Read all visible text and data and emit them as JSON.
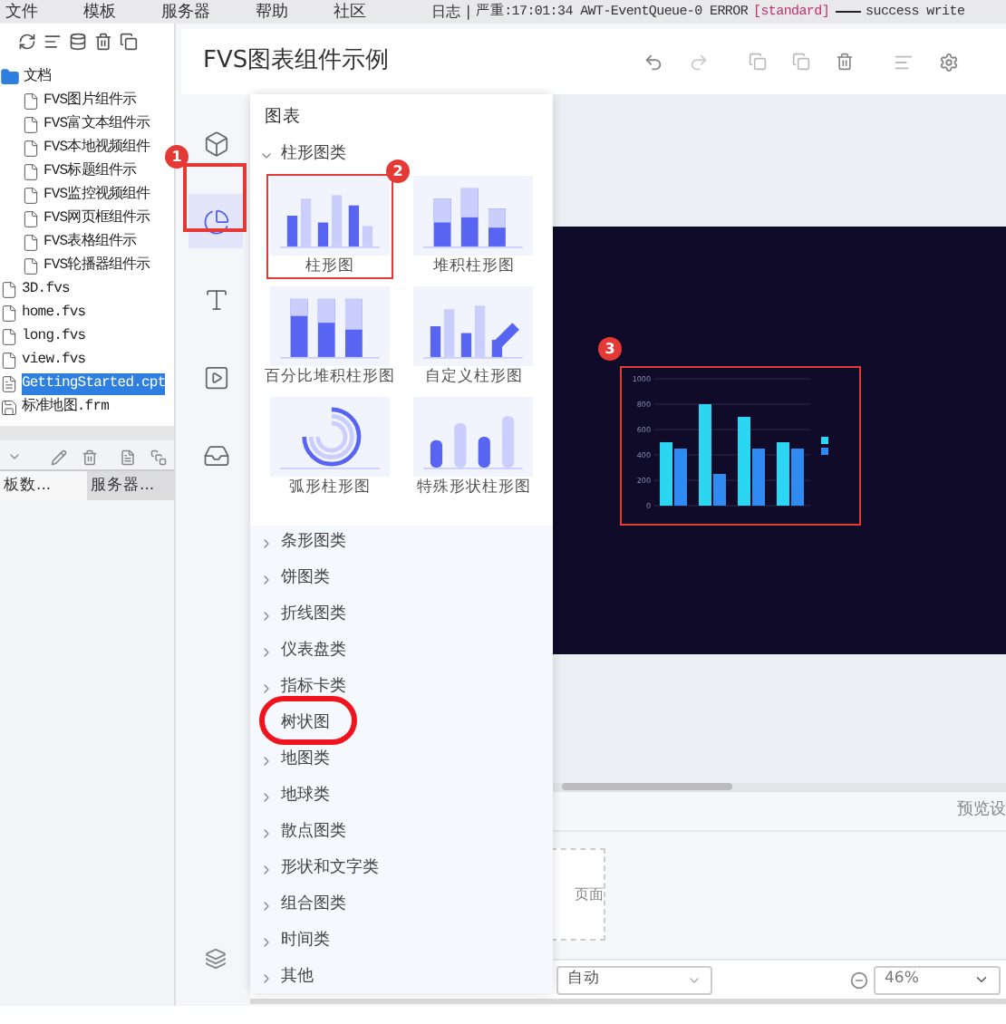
{
  "menubar": {
    "items": [
      "文件",
      "模板",
      "服务器",
      "帮助",
      "社区"
    ],
    "log": {
      "label": "日志",
      "separator": "|",
      "message": "严重:17:01:34 AWT-EventQueue-0 ERROR",
      "tag": "[standard]",
      "tail": "success write"
    }
  },
  "file_tree": [
    {
      "label": "文档",
      "kind": "folder",
      "selected": false,
      "children": [
        {
          "label": "FVS图片组件示",
          "kind": "file",
          "selected": false
        },
        {
          "label": "FVS富文本组件示",
          "kind": "file",
          "selected": false
        },
        {
          "label": "FVS本地视频组件",
          "kind": "file",
          "selected": false
        },
        {
          "label": "FVS标题组件示",
          "kind": "file",
          "selected": false
        },
        {
          "label": "FVS监控视频组件",
          "kind": "file",
          "selected": false
        },
        {
          "label": "FVS网页框组件示",
          "kind": "file",
          "selected": false
        },
        {
          "label": "FVS表格组件示",
          "kind": "file",
          "selected": false
        },
        {
          "label": "FVS轮播器组件示",
          "kind": "file",
          "selected": false
        }
      ]
    },
    {
      "label": "3D.fvs",
      "kind": "file",
      "selected": false
    },
    {
      "label": "home.fvs",
      "kind": "file",
      "selected": false
    },
    {
      "label": "long.fvs",
      "kind": "file",
      "selected": false
    },
    {
      "label": "view.fvs",
      "kind": "file",
      "selected": false
    },
    {
      "label": "GettingStarted.cpt",
      "kind": "report",
      "selected": true
    },
    {
      "label": "标准地图.frm",
      "kind": "form",
      "selected": false
    }
  ],
  "left_tabs": [
    {
      "label": "板数...",
      "selected": false
    },
    {
      "label": "服务器...",
      "selected": true
    }
  ],
  "editor": {
    "title": "FVS图表组件示例"
  },
  "rail": [
    {
      "selected": false
    },
    {
      "selected": true
    },
    {
      "selected": false
    },
    {
      "selected": false
    },
    {
      "selected": false
    }
  ],
  "chart_panel": {
    "title": "图表",
    "groups": [
      {
        "label": "柱形图类",
        "kind": "group",
        "expanded": true,
        "tiles": [
          {
            "label": "柱形图",
            "selected": true
          },
          {
            "label": "堆积柱形图",
            "selected": false
          },
          {
            "label": "百分比堆积柱形图",
            "selected": false
          },
          {
            "label": "自定义柱形图",
            "selected": false
          },
          {
            "label": "弧形柱形图",
            "selected": false
          },
          {
            "label": "特殊形状柱形图",
            "selected": false
          }
        ]
      },
      {
        "label": "条形图类",
        "kind": "group",
        "expanded": false
      },
      {
        "label": "饼图类",
        "kind": "group",
        "expanded": false
      },
      {
        "label": "折线图类",
        "kind": "group",
        "expanded": false
      },
      {
        "label": "仪表盘类",
        "kind": "group",
        "expanded": false
      },
      {
        "label": "指标卡类",
        "kind": "group",
        "expanded": false
      },
      {
        "label": "树状图",
        "kind": "leaf"
      },
      {
        "label": "地图类",
        "kind": "group",
        "expanded": false
      },
      {
        "label": "地球类",
        "kind": "group",
        "expanded": false
      },
      {
        "label": "散点图类",
        "kind": "group",
        "expanded": false
      },
      {
        "label": "形状和文字类",
        "kind": "group",
        "expanded": false
      },
      {
        "label": "组合图类",
        "kind": "group",
        "expanded": false
      },
      {
        "label": "时间类",
        "kind": "group",
        "expanded": false
      },
      {
        "label": "其他",
        "kind": "group",
        "expanded": false
      }
    ]
  },
  "annotations": [
    {
      "number": "1"
    },
    {
      "number": "2"
    },
    {
      "number": "3"
    }
  ],
  "canvas": {
    "chart_data": {
      "type": "bar",
      "grid": true,
      "yticks": [
        0,
        200,
        400,
        600,
        800,
        1000
      ],
      "ylim": [
        0,
        1000
      ],
      "series": [
        {
          "color": "#2bd6f2",
          "values": [
            500,
            800,
            700,
            500
          ]
        },
        {
          "color": "#2f8bf2",
          "values": [
            450,
            250,
            450,
            450
          ]
        }
      ]
    }
  },
  "footer": {
    "preview_label": "预览设",
    "page_label": "页面",
    "layout_select": "自动",
    "zoom": "46%"
  }
}
